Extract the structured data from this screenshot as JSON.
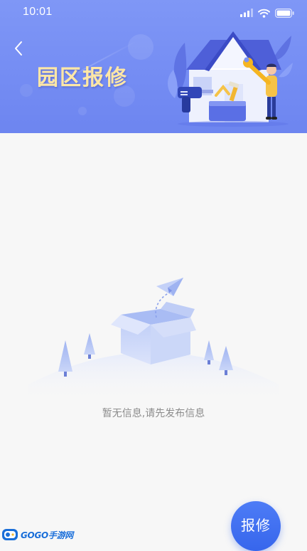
{
  "status_bar": {
    "time": "10:01"
  },
  "header": {
    "title": "园区报修",
    "back_icon": "chevron-left-icon",
    "illustration": "house-repair-illustration",
    "colors": {
      "background": "#7b93f5",
      "title": "#ffe7a6"
    }
  },
  "empty_state": {
    "illustration": "open-box-paper-plane-illustration",
    "message": "暂无信息,请先发布信息"
  },
  "fab": {
    "label": "报修",
    "color": "#3d6ff0"
  },
  "watermark": {
    "text": "GOGO手游网"
  }
}
